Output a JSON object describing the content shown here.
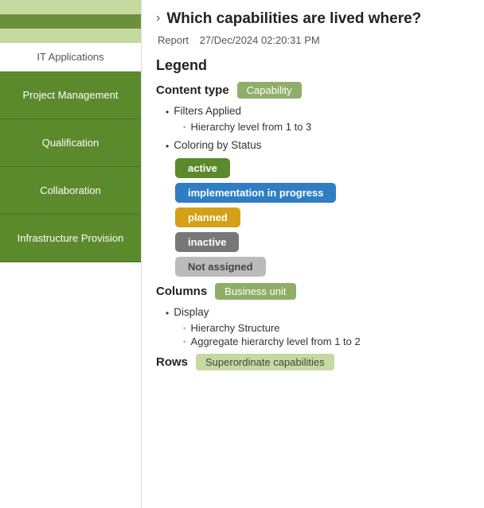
{
  "sidebar": {
    "stripes": [
      {
        "type": "light"
      },
      {
        "type": "dark"
      },
      {
        "type": "light"
      }
    ],
    "items": [
      {
        "label": "IT Applications",
        "type": "label"
      },
      {
        "label": "Project Management",
        "type": "green"
      },
      {
        "label": "Qualification",
        "type": "green"
      },
      {
        "label": "Collaboration",
        "type": "green"
      },
      {
        "label": "Infrastructure Provision",
        "type": "green"
      }
    ]
  },
  "report": {
    "chevron": "›",
    "title": "Which capabilities are lived where?",
    "meta_type": "Report",
    "meta_date": "27/Dec/2024 02:20:31 PM"
  },
  "legend": {
    "title": "Legend",
    "content_type_label": "Content type",
    "content_type_badge": "Capability",
    "filters_label": "Filters Applied",
    "hierarchy_filter": "Hierarchy level from 1 to 3",
    "coloring_label": "Coloring by Status",
    "statuses": [
      {
        "label": "active",
        "class": "status-active"
      },
      {
        "label": "implementation in progress",
        "class": "status-implementation"
      },
      {
        "label": "planned",
        "class": "status-planned"
      },
      {
        "label": "inactive",
        "class": "status-inactive"
      },
      {
        "label": "Not assigned",
        "class": "status-not-assigned"
      }
    ],
    "columns_label": "Columns",
    "columns_badge": "Business unit",
    "display_label": "Display",
    "display_items": [
      "Hierarchy Structure",
      "Aggregate hierarchy level from 1 to 2"
    ],
    "rows_label": "Rows",
    "rows_badge": "Superordinate capabilities"
  }
}
